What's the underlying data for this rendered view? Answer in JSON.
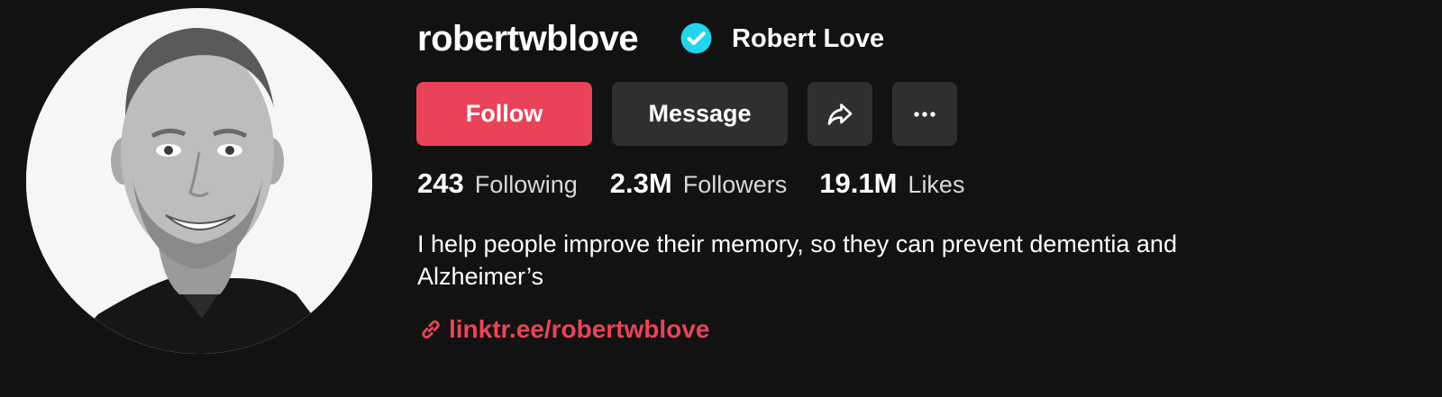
{
  "profile": {
    "username": "robertwblove",
    "display_name": "Robert Love",
    "verified": true,
    "verified_icon": "verified-check-badge-icon",
    "bio": "I help people improve their memory, so they can prevent dementia and Alzheimer’s",
    "link": "linktr.ee/robertwblove",
    "link_icon": "link-chain-icon"
  },
  "actions": {
    "follow_label": "Follow",
    "message_label": "Message",
    "share_icon": "share-arrow-icon",
    "more_icon": "more-dots-icon"
  },
  "stats": [
    {
      "value": "243",
      "label": "Following"
    },
    {
      "value": "2.3M",
      "label": "Followers"
    },
    {
      "value": "19.1M",
      "label": "Likes"
    }
  ],
  "colors": {
    "background": "#121212",
    "accent": "#ea4359",
    "button_secondary": "#2f2f2f",
    "verified_badge": "#20d5ec",
    "secondary_text": "#d9d9d9"
  }
}
